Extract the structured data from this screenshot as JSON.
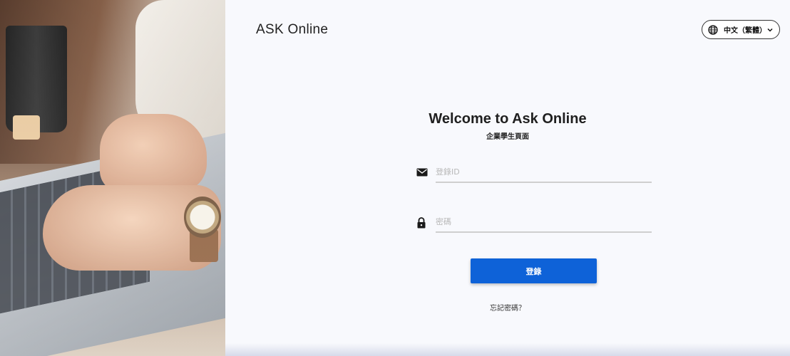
{
  "brand": {
    "name": "ASK Online"
  },
  "language_selector": {
    "selected": "中文（繁體）",
    "icon": "globe-icon",
    "chevron": "chevron-down-icon"
  },
  "login": {
    "title": "Welcome to Ask Online",
    "subtitle": "企業學生頁面",
    "id_field": {
      "placeholder": "登錄ID",
      "value": "",
      "icon": "mail-icon"
    },
    "password_field": {
      "placeholder": "密碼",
      "value": "",
      "icon": "lock-icon"
    },
    "submit_label": "登錄",
    "forgot_label": "忘記密碼？"
  },
  "colors": {
    "primary": "#0e62d8",
    "background": "#f8f9fd",
    "text": "#222222"
  }
}
